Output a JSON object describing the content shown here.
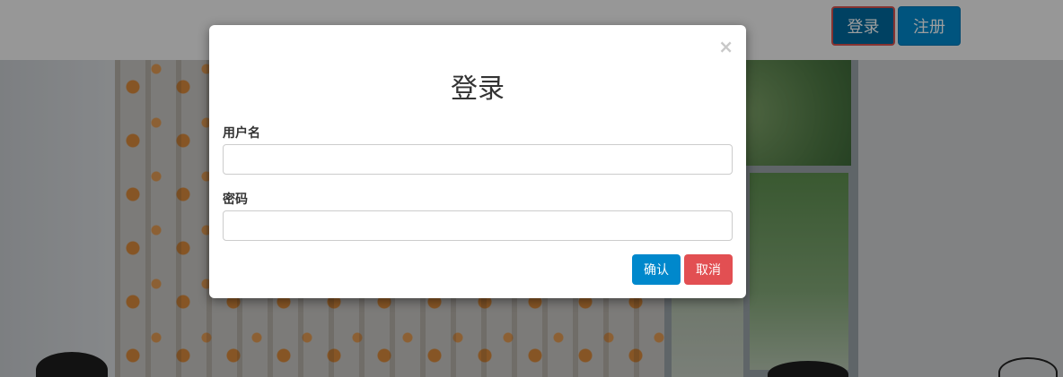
{
  "navbar": {
    "login_label": "登录",
    "register_label": "注册"
  },
  "modal": {
    "close_symbol": "×",
    "title": "登录",
    "username_label": "用户名",
    "username_value": "",
    "password_label": "密码",
    "password_value": "",
    "confirm_label": "确认",
    "cancel_label": "取消"
  },
  "colors": {
    "primary": "#0088cc",
    "danger": "#e24f52",
    "overlay": "rgba(0,0,0,0.38)"
  }
}
